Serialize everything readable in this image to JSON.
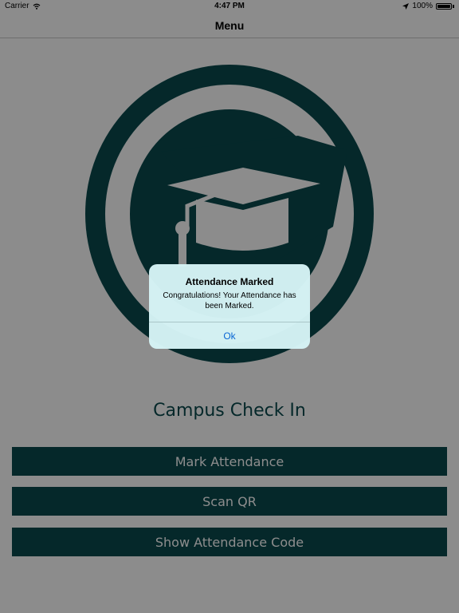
{
  "status_bar": {
    "carrier": "Carrier",
    "time": "4:47 PM",
    "battery": "100%",
    "battery_level": 1.0
  },
  "nav": {
    "title": "Menu"
  },
  "app": {
    "title": "Campus Check In"
  },
  "buttons": {
    "mark_attendance": "Mark Attendance",
    "scan_qr": "Scan QR",
    "show_attendance_code": "Show Attendance Code"
  },
  "alert": {
    "title": "Attendance Marked",
    "message": "Congratulations! Your Attendance has been Marked.",
    "ok_label": "Ok"
  },
  "colors": {
    "brand": "#0a4a4e",
    "alert_button": "#0a66d4"
  },
  "icons": {
    "logo": "graduation-cap-logo",
    "wifi": "wifi-icon",
    "location": "location-arrow-icon",
    "battery": "battery-icon"
  }
}
